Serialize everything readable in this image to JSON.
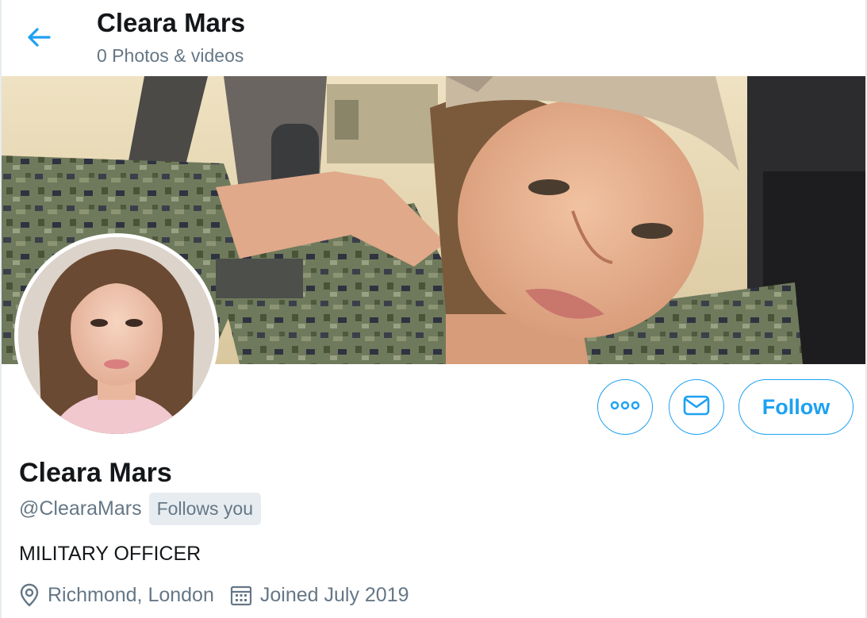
{
  "header": {
    "title": "Cleara Mars",
    "subtitle": "0 Photos & videos"
  },
  "profile": {
    "name": "Cleara Mars",
    "handle": "@ClearaMars",
    "follows_you": "Follows you",
    "bio": "MILITARY OFFICER",
    "location": "Richmond, London",
    "joined": "Joined July 2019"
  },
  "actions": {
    "follow_label": "Follow"
  },
  "icons": {
    "back": "back-arrow-icon",
    "more": "more-options-icon",
    "message": "envelope-icon",
    "location": "location-pin-icon",
    "calendar": "calendar-icon"
  },
  "colors": {
    "accent": "#1da1f2",
    "secondary_text": "#657786",
    "badge_bg": "#e6ecf0",
    "primary_text": "#14171a"
  }
}
